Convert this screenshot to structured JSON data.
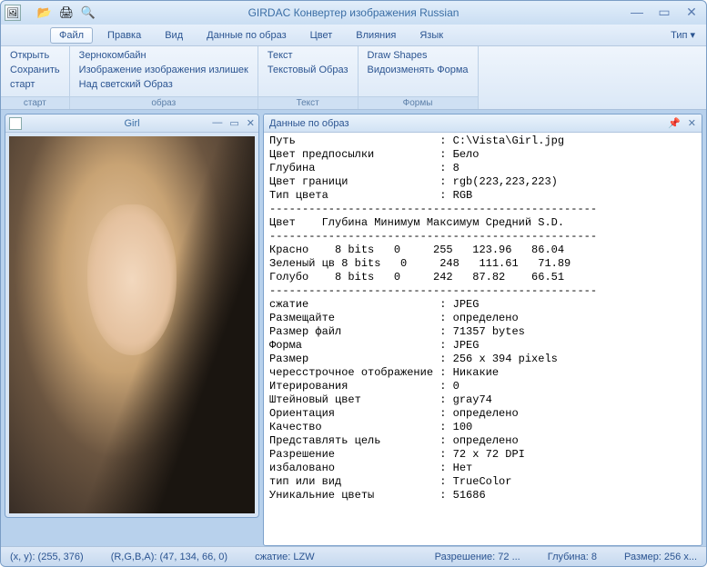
{
  "title": "GIRDAC Конвертер изображения Russian",
  "menu": {
    "items": [
      "Файл",
      "Правка",
      "Вид",
      "Данные по образ",
      "Цвет",
      "Влияния",
      "Язык"
    ],
    "right": "Тип ▾"
  },
  "ribbon": {
    "groups": [
      {
        "label": "старт",
        "items": [
          "Открыть",
          "Сохранить",
          "старт"
        ]
      },
      {
        "label": "образ",
        "items": [
          "Зернокомбайн",
          "Изображение изображения излишек",
          "Над светский Образ"
        ]
      },
      {
        "label": "Текст",
        "items": [
          "Текст",
          "Текстовый Образ"
        ]
      },
      {
        "label": "Формы",
        "items": [
          "Draw Shapes",
          "Видоизменять Форма"
        ]
      }
    ]
  },
  "childwindow": {
    "title": "Girl"
  },
  "panel": {
    "title": "Данные по образ"
  },
  "info": {
    "kv": [
      [
        "Путь",
        "C:\\Vista\\Girl.jpg"
      ],
      [
        "Цвет предпосылки",
        "Бело"
      ],
      [
        "Глубина",
        "8"
      ],
      [
        "Цвет граници",
        "rgb(223,223,223)"
      ],
      [
        "Тип цвета",
        "RGB"
      ]
    ],
    "colHeader": "Цвет    Глубина Минимум Максимум Средний S.D.",
    "rows": [
      "Красно    8 bits   0     255   123.96   86.04",
      "Зеленый цв 8 bits   0     248   111.61   71.89",
      "Голубо    8 bits   0     242   87.82    66.51"
    ],
    "kv2": [
      [
        "сжатие",
        "JPEG"
      ],
      [
        "Размещайте",
        "определено"
      ],
      [
        "Размер файл",
        "71357 bytes"
      ],
      [
        "Форма",
        "JPEG"
      ],
      [
        "Размер",
        "256 x 394 pixels"
      ],
      [
        "чересстрочное отображение",
        "Никакие"
      ],
      [
        "Итерирования",
        "0"
      ],
      [
        "Штейновый цвет",
        "gray74"
      ],
      [
        "Ориентация",
        "определено"
      ],
      [
        "Качество",
        "100"
      ],
      [
        "Представлять цель",
        "определено"
      ],
      [
        "Разрешение",
        "72 x 72 DPI"
      ],
      [
        "избаловано",
        "Нет"
      ],
      [
        "тип или вид",
        "TrueColor"
      ],
      [
        "Уникальние цветы",
        "51686"
      ]
    ]
  },
  "statusbar": {
    "coords": "(x, y): (255, 376)",
    "rgba": "(R,G,B,A): (47, 134, 66, 0)",
    "compression": "сжатие: LZW",
    "resolution": "Разрешение: 72 ...",
    "depth": "Глубина: 8",
    "size": "Размер: 256 x..."
  }
}
